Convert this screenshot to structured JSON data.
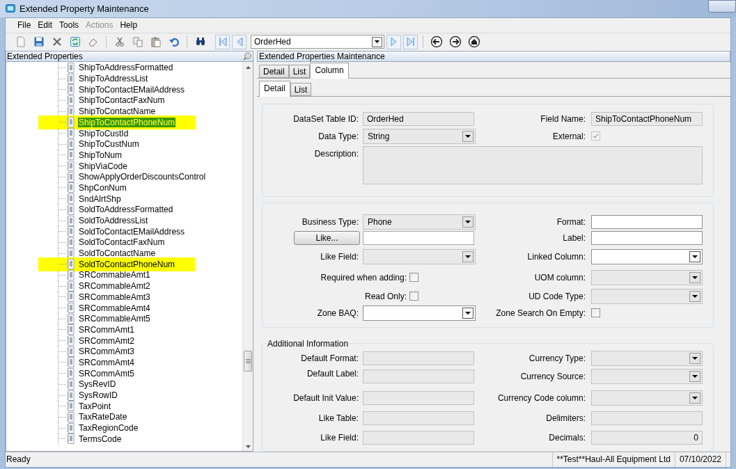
{
  "window": {
    "title": "Extended Property Maintenance"
  },
  "menu": [
    {
      "label": "File",
      "disabled": false
    },
    {
      "label": "Edit",
      "disabled": false
    },
    {
      "label": "Tools",
      "disabled": false
    },
    {
      "label": "Actions",
      "disabled": true
    },
    {
      "label": "Help",
      "disabled": false
    }
  ],
  "toolbar": {
    "record": "OrderHed"
  },
  "tree": {
    "title": "Extended Properties",
    "items": [
      {
        "label": "ShipToAddressFormatted",
        "selected": false,
        "highlighted": false
      },
      {
        "label": "ShipToAddressList",
        "selected": false,
        "highlighted": false
      },
      {
        "label": "ShipToContactEMailAddress",
        "selected": false,
        "highlighted": false
      },
      {
        "label": "ShipToContactFaxNum",
        "selected": false,
        "highlighted": false
      },
      {
        "label": "ShipToContactName",
        "selected": false,
        "highlighted": false
      },
      {
        "label": "ShipToContactPhoneNum",
        "selected": true,
        "highlighted": true
      },
      {
        "label": "ShipToCustId",
        "selected": false,
        "highlighted": false
      },
      {
        "label": "ShipToCustNum",
        "selected": false,
        "highlighted": false
      },
      {
        "label": "ShipToNum",
        "selected": false,
        "highlighted": false
      },
      {
        "label": "ShipViaCode",
        "selected": false,
        "highlighted": false
      },
      {
        "label": "ShowApplyOrderDiscountsControl",
        "selected": false,
        "highlighted": false
      },
      {
        "label": "ShpConNum",
        "selected": false,
        "highlighted": false
      },
      {
        "label": "SndAlrtShp",
        "selected": false,
        "highlighted": false
      },
      {
        "label": "SoldToAddressFormatted",
        "selected": false,
        "highlighted": false
      },
      {
        "label": "SoldToAddressList",
        "selected": false,
        "highlighted": false
      },
      {
        "label": "SoldToContactEMailAddress",
        "selected": false,
        "highlighted": false
      },
      {
        "label": "SoldToContactFaxNum",
        "selected": false,
        "highlighted": false
      },
      {
        "label": "SoldToContactName",
        "selected": false,
        "highlighted": false
      },
      {
        "label": "SoldToContactPhoneNum",
        "selected": false,
        "highlighted": true
      },
      {
        "label": "SRCommableAmt1",
        "selected": false,
        "highlighted": false
      },
      {
        "label": "SRCommableAmt2",
        "selected": false,
        "highlighted": false
      },
      {
        "label": "SRCommableAmt3",
        "selected": false,
        "highlighted": false
      },
      {
        "label": "SRCommableAmt4",
        "selected": false,
        "highlighted": false
      },
      {
        "label": "SRCommableAmt5",
        "selected": false,
        "highlighted": false
      },
      {
        "label": "SRCommAmt1",
        "selected": false,
        "highlighted": false
      },
      {
        "label": "SRCommAmt2",
        "selected": false,
        "highlighted": false
      },
      {
        "label": "SRCommAmt3",
        "selected": false,
        "highlighted": false
      },
      {
        "label": "SRCommAmt4",
        "selected": false,
        "highlighted": false
      },
      {
        "label": "SRCommAmt5",
        "selected": false,
        "highlighted": false
      },
      {
        "label": "SysRevID",
        "selected": false,
        "highlighted": false
      },
      {
        "label": "SysRowID",
        "selected": false,
        "highlighted": false
      },
      {
        "label": "TaxPoint",
        "selected": false,
        "highlighted": false
      },
      {
        "label": "TaxRateDate",
        "selected": false,
        "highlighted": false
      },
      {
        "label": "TaxRegionCode",
        "selected": false,
        "highlighted": false
      },
      {
        "label": "TermsCode",
        "selected": false,
        "highlighted": false
      }
    ]
  },
  "detail": {
    "title": "Extended Properties Maintenance",
    "tabs": [
      {
        "label": "Detail",
        "selected": false
      },
      {
        "label": "List",
        "selected": false
      },
      {
        "label": "Column",
        "selected": true
      }
    ],
    "subtabs": [
      {
        "label": "Detail",
        "selected": true
      },
      {
        "label": "List",
        "selected": false
      }
    ],
    "groups": [
      {
        "rows": [
          {
            "left": {
              "kind": "text",
              "label": "DataSet Table ID:",
              "value": "OrderHed",
              "disabled": true
            },
            "right": {
              "kind": "text",
              "label": "Field Name:",
              "value": "ShipToContactPhoneNum",
              "disabled": true
            }
          },
          {
            "left": {
              "kind": "dropdown",
              "label": "Data Type:",
              "value": "String",
              "disabled": true
            },
            "right": {
              "kind": "checkbox",
              "label": "External:",
              "checked": true,
              "disabled": true
            }
          },
          {
            "left": {
              "kind": "textarea",
              "label": "Description:",
              "disabled": true
            }
          }
        ]
      },
      {
        "rows": [
          {
            "left": {
              "kind": "dropdown",
              "label": "Business Type:",
              "value": "Phone",
              "disabled": true
            },
            "right": {
              "kind": "text",
              "label": "Format:",
              "disabled": false
            }
          },
          {
            "left": {
              "kind": "button_field",
              "button": "Like...",
              "disabled": false
            },
            "right": {
              "kind": "text",
              "label": "Label:",
              "disabled": false
            }
          },
          {
            "left": {
              "kind": "dropdown",
              "label": "Like Field:",
              "disabled": true
            },
            "right": {
              "kind": "dropdown",
              "label": "Linked Column:",
              "disabled": false
            }
          },
          {
            "left": {
              "kind": "checkbox",
              "label": "Required when adding:",
              "checked": false,
              "disabled": false
            },
            "right": {
              "kind": "dropdown",
              "label": "UOM column:",
              "disabled": true
            }
          },
          {
            "left": {
              "kind": "checkbox",
              "label": "Read Only:",
              "checked": false,
              "disabled": false
            },
            "right": {
              "kind": "dropdown",
              "label": "UD Code Type:",
              "disabled": true
            }
          },
          {
            "left": {
              "kind": "dropdown",
              "label": "Zone BAQ:",
              "disabled": false
            },
            "right": {
              "kind": "checkbox",
              "label": "Zone Search On Empty:",
              "checked": false,
              "disabled": false
            }
          }
        ]
      },
      {
        "title": "Additional Information",
        "rows": [
          {
            "left": {
              "kind": "text",
              "label": "Default Format:",
              "disabled": true
            },
            "right": {
              "kind": "dropdown",
              "label": "Currency Type:",
              "disabled": true
            }
          },
          {
            "left": {
              "kind": "text",
              "label": "Default Label:",
              "disabled": true
            },
            "right": {
              "kind": "dropdown",
              "label": "Currency Source:",
              "disabled": true
            }
          },
          {
            "left": {
              "kind": "text",
              "label": "Default Init Value:",
              "disabled": true
            },
            "right": {
              "kind": "dropdown",
              "label": "Currency Code column:",
              "disabled": true
            }
          },
          {
            "left": {
              "kind": "text",
              "label": "Like Table:",
              "disabled": true
            },
            "right": {
              "kind": "text",
              "label": "Delimiters:",
              "disabled": true
            }
          },
          {
            "left": {
              "kind": "text",
              "label": "Like Field:",
              "disabled": true
            },
            "right": {
              "kind": "number",
              "label": "Decimals:",
              "value": "0",
              "disabled": true
            }
          }
        ]
      }
    ]
  },
  "status_bar": {
    "message": "Ready",
    "company": "**Test**Haul-All Equipment Ltd",
    "date": "07/10/2022"
  }
}
